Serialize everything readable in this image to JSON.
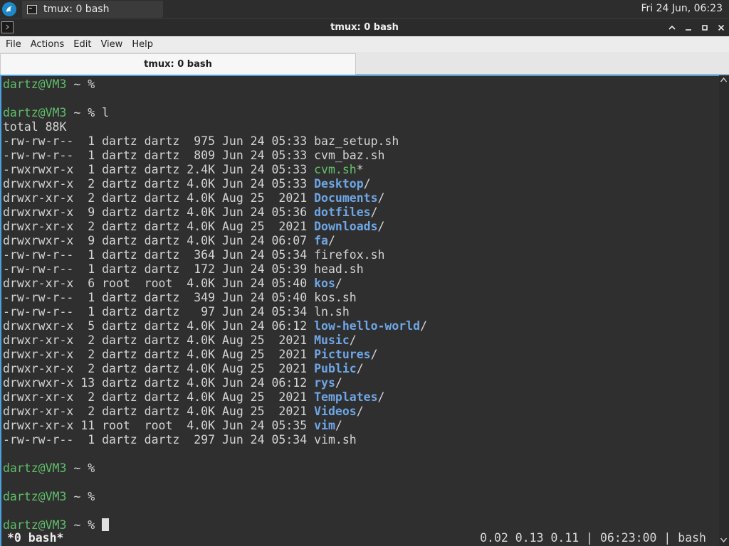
{
  "panel": {
    "launcher_icon": "distro-logo-icon",
    "task_label": "tmux: 0 bash",
    "clock": "Fri 24 Jun, 06:23"
  },
  "window": {
    "title": "tmux: 0 bash",
    "controls": [
      "minimize-up-icon",
      "minimize-icon",
      "maximize-icon",
      "close-icon"
    ]
  },
  "menu": {
    "file": "File",
    "actions": "Actions",
    "edit": "Edit",
    "view": "View",
    "help": "Help"
  },
  "tab": {
    "label": "tmux: 0 bash"
  },
  "terminal": {
    "prompt_user": "dartz",
    "prompt_host": "@VM3",
    "prompt_dir": " ~ % ",
    "colors": {
      "prompt": "#5fbf6a",
      "directory": "#6ea6e6",
      "executable": "#63c46b"
    },
    "lines": [
      {
        "type": "prompt",
        "cmd": ""
      },
      {
        "type": "blank"
      },
      {
        "type": "prompt",
        "cmd": "l"
      },
      {
        "type": "text",
        "text": "total 88K"
      },
      {
        "type": "ls",
        "meta": "-rw-rw-r--  1 dartz dartz  975 Jun 24 05:33 ",
        "name": "baz_setup.sh",
        "kind": "file",
        "suffix": ""
      },
      {
        "type": "ls",
        "meta": "-rw-rw-r--  1 dartz dartz  809 Jun 24 05:33 ",
        "name": "cvm_baz.sh",
        "kind": "file",
        "suffix": ""
      },
      {
        "type": "ls",
        "meta": "-rwxrwxr-x  1 dartz dartz 2.4K Jun 24 05:33 ",
        "name": "cvm.sh",
        "kind": "exec",
        "suffix": "*"
      },
      {
        "type": "ls",
        "meta": "drwxrwxr-x  2 dartz dartz 4.0K Jun 24 05:33 ",
        "name": "Desktop",
        "kind": "dir",
        "suffix": "/"
      },
      {
        "type": "ls",
        "meta": "drwxr-xr-x  2 dartz dartz 4.0K Aug 25  2021 ",
        "name": "Documents",
        "kind": "dir",
        "suffix": "/"
      },
      {
        "type": "ls",
        "meta": "drwxrwxr-x  9 dartz dartz 4.0K Jun 24 05:36 ",
        "name": "dotfiles",
        "kind": "dir",
        "suffix": "/"
      },
      {
        "type": "ls",
        "meta": "drwxr-xr-x  2 dartz dartz 4.0K Aug 25  2021 ",
        "name": "Downloads",
        "kind": "dir",
        "suffix": "/"
      },
      {
        "type": "ls",
        "meta": "drwxrwxr-x  9 dartz dartz 4.0K Jun 24 06:07 ",
        "name": "fa",
        "kind": "dir",
        "suffix": "/"
      },
      {
        "type": "ls",
        "meta": "-rw-rw-r--  1 dartz dartz  364 Jun 24 05:34 ",
        "name": "firefox.sh",
        "kind": "file",
        "suffix": ""
      },
      {
        "type": "ls",
        "meta": "-rw-rw-r--  1 dartz dartz  172 Jun 24 05:39 ",
        "name": "head.sh",
        "kind": "file",
        "suffix": ""
      },
      {
        "type": "ls",
        "meta": "drwxr-xr-x  6 root  root  4.0K Jun 24 05:40 ",
        "name": "kos",
        "kind": "dir",
        "suffix": "/"
      },
      {
        "type": "ls",
        "meta": "-rw-rw-r--  1 dartz dartz  349 Jun 24 05:40 ",
        "name": "kos.sh",
        "kind": "file",
        "suffix": ""
      },
      {
        "type": "ls",
        "meta": "-rw-rw-r--  1 dartz dartz   97 Jun 24 05:34 ",
        "name": "ln.sh",
        "kind": "file",
        "suffix": ""
      },
      {
        "type": "ls",
        "meta": "drwxrwxr-x  5 dartz dartz 4.0K Jun 24 06:12 ",
        "name": "low-hello-world",
        "kind": "dir",
        "suffix": "/"
      },
      {
        "type": "ls",
        "meta": "drwxr-xr-x  2 dartz dartz 4.0K Aug 25  2021 ",
        "name": "Music",
        "kind": "dir",
        "suffix": "/"
      },
      {
        "type": "ls",
        "meta": "drwxr-xr-x  2 dartz dartz 4.0K Aug 25  2021 ",
        "name": "Pictures",
        "kind": "dir",
        "suffix": "/"
      },
      {
        "type": "ls",
        "meta": "drwxr-xr-x  2 dartz dartz 4.0K Aug 25  2021 ",
        "name": "Public",
        "kind": "dir",
        "suffix": "/"
      },
      {
        "type": "ls",
        "meta": "drwxrwxr-x 13 dartz dartz 4.0K Jun 24 06:12 ",
        "name": "rys",
        "kind": "dir",
        "suffix": "/"
      },
      {
        "type": "ls",
        "meta": "drwxr-xr-x  2 dartz dartz 4.0K Aug 25  2021 ",
        "name": "Templates",
        "kind": "dir",
        "suffix": "/"
      },
      {
        "type": "ls",
        "meta": "drwxr-xr-x  2 dartz dartz 4.0K Aug 25  2021 ",
        "name": "Videos",
        "kind": "dir",
        "suffix": "/"
      },
      {
        "type": "ls",
        "meta": "drwxr-xr-x 11 root  root  4.0K Jun 24 05:35 ",
        "name": "vim",
        "kind": "dir",
        "suffix": "/"
      },
      {
        "type": "ls",
        "meta": "-rw-rw-r--  1 dartz dartz  297 Jun 24 05:34 ",
        "name": "vim.sh",
        "kind": "file",
        "suffix": ""
      },
      {
        "type": "blank"
      },
      {
        "type": "prompt",
        "cmd": ""
      },
      {
        "type": "blank"
      },
      {
        "type": "prompt",
        "cmd": ""
      },
      {
        "type": "blank"
      },
      {
        "type": "prompt",
        "cmd": "",
        "cursor": true
      }
    ]
  },
  "tmux_status": {
    "left": "*0 bash*",
    "right": "0.02 0.13 0.11 | 06:23:00 | bash"
  }
}
